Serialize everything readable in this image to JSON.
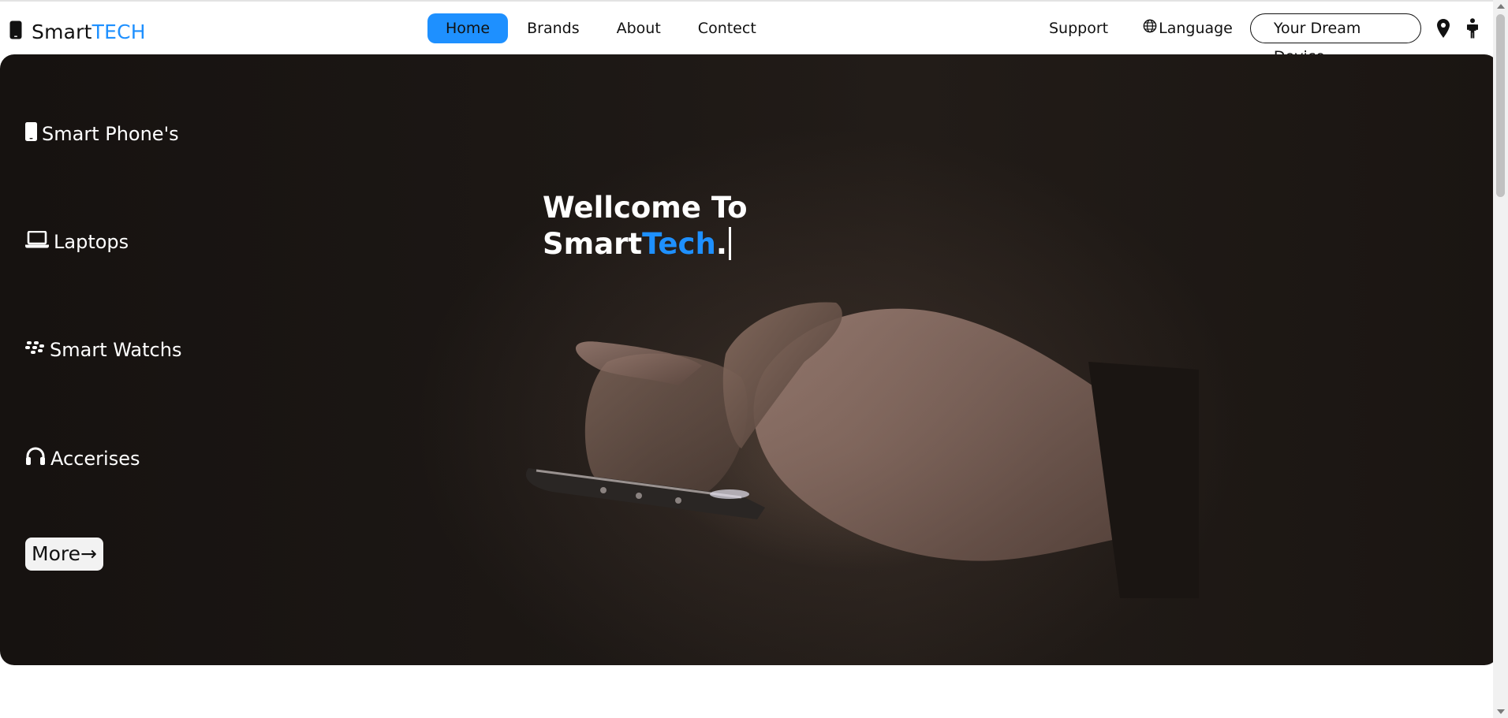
{
  "brand": {
    "name_prefix": "Smart",
    "name_suffix": "TECH"
  },
  "nav": {
    "items": [
      {
        "label": "Home",
        "active": true
      },
      {
        "label": "Brands",
        "active": false
      },
      {
        "label": "About",
        "active": false
      },
      {
        "label": "Contect",
        "active": false
      }
    ]
  },
  "header_right": {
    "support": "Support",
    "language": "Language",
    "dream_button": "Your Dream Device"
  },
  "hero": {
    "categories": [
      {
        "label": "Smart Phone's",
        "icon": "smartphone-icon"
      },
      {
        "label": "Laptops",
        "icon": "laptop-icon"
      },
      {
        "label": "Smart Watchs",
        "icon": "blackberry-icon"
      },
      {
        "label": "Accerises",
        "icon": "headphones-icon"
      }
    ],
    "more_button": "More→",
    "welcome_line1": "Wellcome To",
    "welcome_word1": "Smart",
    "welcome_word2": "Tech",
    "welcome_punct": "."
  },
  "colors": {
    "accent": "#1e90ff",
    "hero_bg": "#1d1815",
    "text_dark": "#111111"
  }
}
